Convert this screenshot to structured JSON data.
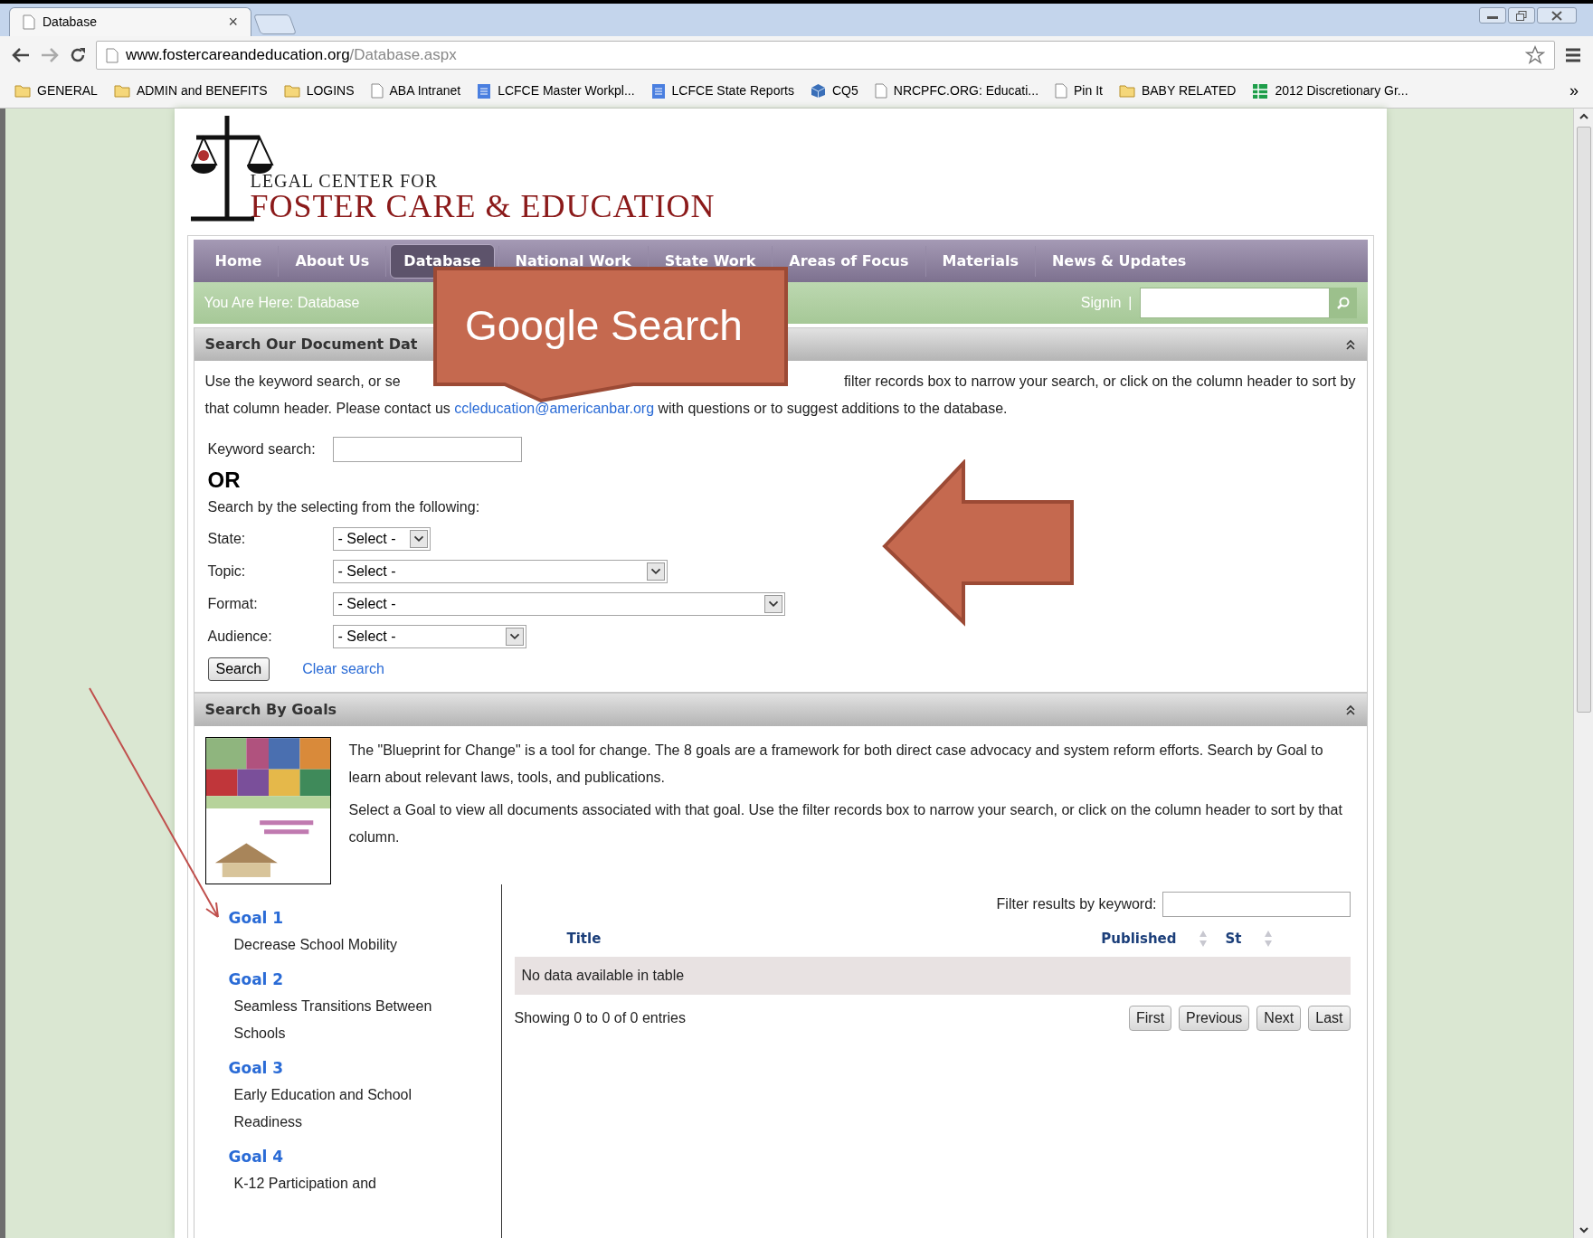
{
  "browser": {
    "tab": {
      "title": "Database",
      "close": "×"
    },
    "url": {
      "host": "www.fostercareandeducation.org",
      "path": "/Database.aspx"
    },
    "bookmarks": [
      {
        "kind": "folder",
        "label": "GENERAL"
      },
      {
        "kind": "folder",
        "label": "ADMIN and BENEFITS"
      },
      {
        "kind": "folder",
        "label": "LOGINS"
      },
      {
        "kind": "page",
        "label": "ABA Intranet"
      },
      {
        "kind": "doc",
        "label": "LCFCE Master Workpl..."
      },
      {
        "kind": "doc",
        "label": "LCFCE State Reports"
      },
      {
        "kind": "cube",
        "label": "CQ5"
      },
      {
        "kind": "page",
        "label": "NRCPFC.ORG: Educati..."
      },
      {
        "kind": "page",
        "label": "Pin It"
      },
      {
        "kind": "folder",
        "label": "BABY RELATED"
      },
      {
        "kind": "sheet",
        "label": "2012 Discretionary Gr..."
      }
    ],
    "more": "»"
  },
  "site": {
    "logo": {
      "line1": "LEGAL CENTER FOR",
      "line2": "FOSTER CARE & EDUCATION"
    },
    "nav": [
      {
        "label": "Home",
        "selected": false
      },
      {
        "label": "About Us",
        "selected": false
      },
      {
        "label": "Database",
        "selected": true
      },
      {
        "label": "National Work",
        "selected": false
      },
      {
        "label": "State Work",
        "selected": false
      },
      {
        "label": "Areas of Focus",
        "selected": false
      },
      {
        "label": "Materials",
        "selected": false
      },
      {
        "label": "News & Updates",
        "selected": false
      }
    ],
    "breadcrumb": "You Are Here: Database",
    "signin": "Signin",
    "separator": "|"
  },
  "document_search": {
    "title": "Search Our Document Dat",
    "intro_start": "Use the keyword search, or se",
    "intro_end": "filter records box to narrow your search, or click on the column header to sort by",
    "intro_line2_before": "that column header. Please contact us ",
    "email": "ccleducation@americanbar.org",
    "intro_line2_after": " with questions or to suggest additions to the database.",
    "keyword_label": "Keyword search:",
    "or": "OR",
    "instruction": "Search by the selecting from the following:",
    "selects": [
      {
        "label": "State:",
        "value": "- Select -"
      },
      {
        "label": "Topic:",
        "value": "- Select -"
      },
      {
        "label": "Format:",
        "value": "- Select -"
      },
      {
        "label": "Audience:",
        "value": "- Select -"
      }
    ],
    "search_button": "Search",
    "clear_link": "Clear search"
  },
  "goals_search": {
    "title": "Search By Goals",
    "image": {
      "kind": "picture"
    },
    "paragraphs": [
      "The \"Blueprint for Change\" is a tool for change. The 8 goals are a framework for both direct case advocacy and system reform efforts. Search by Goal to learn about relevant laws, tools, and publications.",
      "Select a Goal to view all documents associated with that goal. Use the filter records box to narrow your search, or click on the column header to sort by that column."
    ],
    "goals": [
      {
        "label": "Goal 1",
        "description": "Decrease School Mobility"
      },
      {
        "label": "Goal 2",
        "description": "Seamless Transitions Between Schools"
      },
      {
        "label": "Goal 3",
        "description": "Early Education and School Readiness"
      },
      {
        "label": "Goal 4",
        "description": "K-12 Participation and"
      }
    ],
    "filter_label": "Filter results by keyword:",
    "columns": [
      {
        "label": "Title",
        "sortable": false
      },
      {
        "label": "Published",
        "sortable": true
      },
      {
        "label": "St",
        "sortable": true
      }
    ],
    "empty_message": "No data available in table",
    "info": "Showing 0 to 0 of 0 entries",
    "pager": [
      "First",
      "Previous",
      "Next",
      "Last"
    ]
  },
  "annotation": {
    "callout": "Google Search"
  }
}
